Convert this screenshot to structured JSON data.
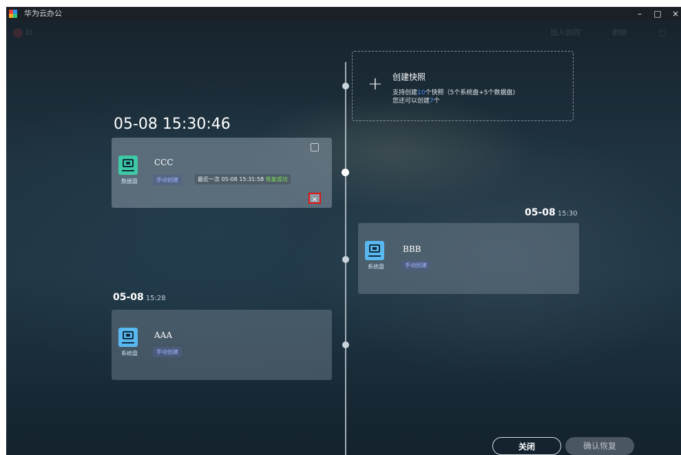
{
  "window": {
    "title": "华为云办公",
    "controls": {
      "minimize": "–",
      "maximize": "□",
      "close": "×"
    }
  },
  "toolbar": {
    "user_label": "XI",
    "join_meeting": "加入协同",
    "refresh": "刷新"
  },
  "create_snapshot": {
    "icon": "plus-icon",
    "title": "创建快照",
    "support_prefix": "支持创建",
    "support_count": "10",
    "support_suffix": "个快照（5个系统盘+5个数据盘)",
    "remaining_prefix": "您还可以创建",
    "remaining_count": "7",
    "remaining_suffix": "个"
  },
  "snapshots": [
    {
      "time_main": "05-08 15:30:46",
      "name": "CCC",
      "disk_type": "数据盘",
      "tag": "手动创建",
      "restore_text": "最近一次 05-08 15:31:58",
      "restore_status": "恢复成功",
      "icon_color": "#3ec9a4"
    },
    {
      "time_main": "05-08",
      "time_small": "15:30",
      "name": "BBB",
      "disk_type": "系统盘",
      "tag": "手动创建",
      "icon_color": "#5ab8f0"
    },
    {
      "time_main": "05-08",
      "time_small": "15:28",
      "name": "AAA",
      "disk_type": "系统盘",
      "tag": "手动创建",
      "icon_color": "#5ab8f0"
    }
  ],
  "buttons": {
    "close": "关闭",
    "confirm_restore": "确认恢复"
  }
}
